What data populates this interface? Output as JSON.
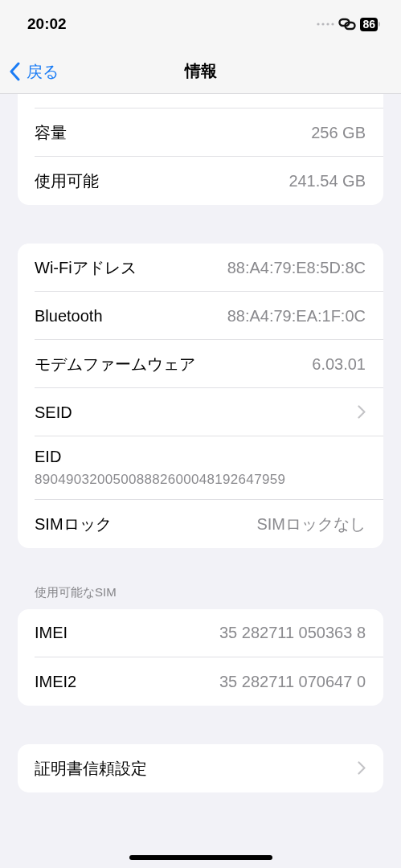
{
  "status_bar": {
    "time": "20:02",
    "battery": "86"
  },
  "nav": {
    "back": "戻る",
    "title": "情報"
  },
  "sections": [
    {
      "rows": [
        {
          "kind": "value",
          "label": "容量",
          "value": "256 GB"
        },
        {
          "kind": "value",
          "label": "使用可能",
          "value": "241.54 GB"
        }
      ]
    },
    {
      "rows": [
        {
          "kind": "value",
          "label": "Wi-Fiアドレス",
          "value": "88:A4:79:E8:5D:8C"
        },
        {
          "kind": "value",
          "label": "Bluetooth",
          "value": "88:A4:79:EA:1F:0C"
        },
        {
          "kind": "value",
          "label": "モデムファームウェア",
          "value": "6.03.01"
        },
        {
          "kind": "chevron",
          "label": "SEID"
        },
        {
          "kind": "stacked",
          "label": "EID",
          "value": "89049032005008882600048192647959"
        },
        {
          "kind": "value",
          "label": "SIMロック",
          "value": "SIMロックなし"
        }
      ]
    },
    {
      "header": "使用可能なSIM",
      "rows": [
        {
          "kind": "value",
          "label": "IMEI",
          "value": "35 282711 050363 8"
        },
        {
          "kind": "value",
          "label": "IMEI2",
          "value": "35 282711 070647 0"
        }
      ]
    },
    {
      "rows": [
        {
          "kind": "chevron",
          "label": "証明書信頼設定"
        }
      ]
    }
  ]
}
